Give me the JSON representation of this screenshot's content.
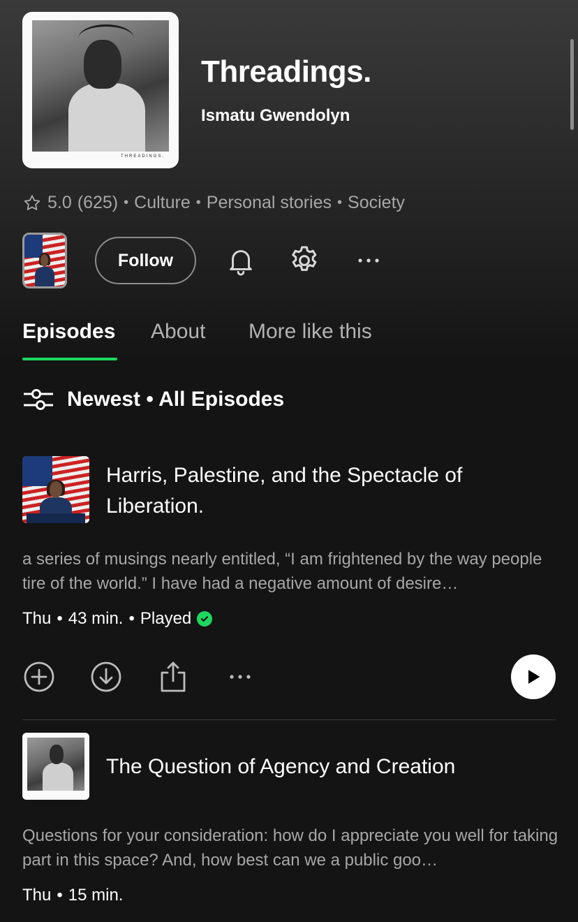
{
  "podcast": {
    "title": "Threadings.",
    "author": "Ismatu Gwendolyn",
    "cover_brand": "THREADINGS.",
    "rating": "5.0",
    "rating_count": "(625)",
    "categories": [
      "Culture",
      "Personal stories",
      "Society"
    ]
  },
  "actions": {
    "follow_label": "Follow"
  },
  "tabs": [
    {
      "label": "Episodes",
      "active": true
    },
    {
      "label": "About",
      "active": false
    },
    {
      "label": "More like this",
      "active": false
    }
  ],
  "filter": {
    "label": "Newest • All Episodes"
  },
  "episodes": [
    {
      "title": "Harris, Palestine, and the Spectacle of Liberation.",
      "description": "a series of musings nearly entitled, “I am frightened by the way people tire of the world.” I have had a negative amount of desire…",
      "day": "Thu",
      "duration": "43 min.",
      "status": "Played"
    },
    {
      "title": "The Question of Agency and Creation",
      "description": "Questions for your consideration: how do I appreciate you well for taking part in this space? And, how best can we a public goo…",
      "day": "Thu",
      "duration": "15 min."
    }
  ],
  "colors": {
    "accent": "#1ed760",
    "text_secondary": "#a7a7a7",
    "background": "#141414"
  }
}
